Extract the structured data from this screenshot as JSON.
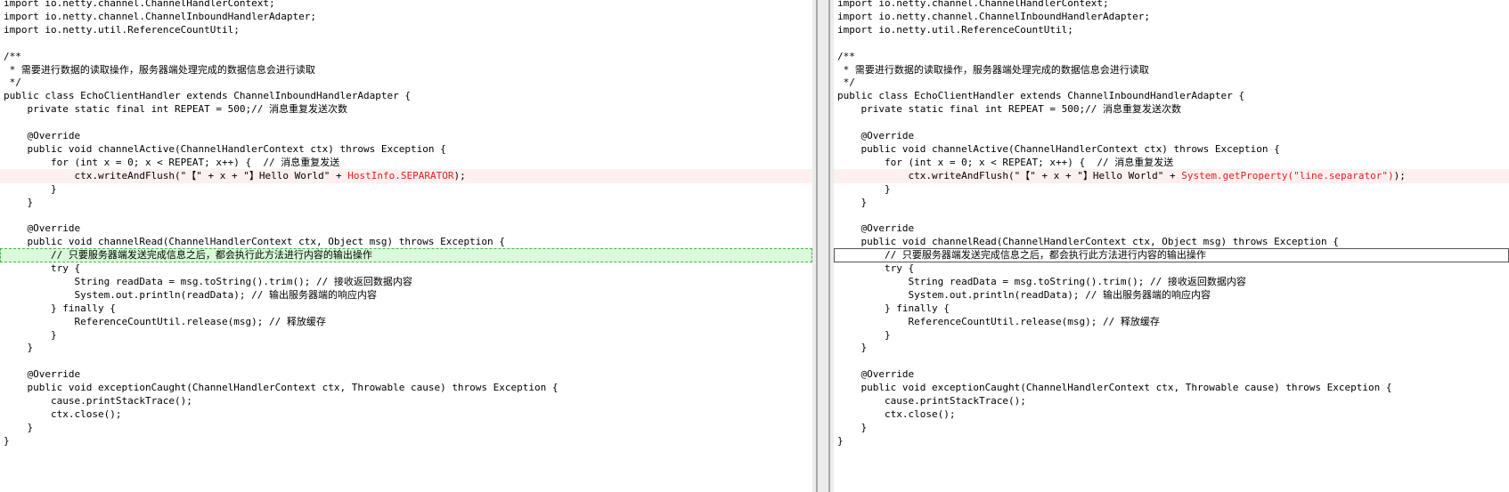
{
  "left": {
    "lines": [
      {
        "text": "import io.netty.channel.ChannelHandlerContext;"
      },
      {
        "text": "import io.netty.channel.ChannelInboundHandlerAdapter;"
      },
      {
        "text": "import io.netty.util.ReferenceCountUtil;"
      },
      {
        "text": ""
      },
      {
        "text": "/**"
      },
      {
        "text": " * 需要进行数据的读取操作，服务器端处理完成的数据信息会进行读取"
      },
      {
        "text": " */"
      },
      {
        "text": "public class EchoClientHandler extends ChannelInboundHandlerAdapter {"
      },
      {
        "text": "    private static final int REPEAT = 500;// 消息重复发送次数"
      },
      {
        "text": ""
      },
      {
        "text": "    @Override"
      },
      {
        "text": "    public void channelActive(ChannelHandlerContext ctx) throws Exception {"
      },
      {
        "text": "        for (int x = 0; x < REPEAT; x++) {  // 消息重复发送"
      },
      {
        "text": "            ctx.writeAndFlush(\"【\" + x + \"】Hello World\" + ",
        "hl": "HostInfo.SEPARATOR",
        "tail": ");",
        "state": "changed"
      },
      {
        "text": "        }"
      },
      {
        "text": "    }"
      },
      {
        "text": ""
      },
      {
        "text": "    @Override"
      },
      {
        "text": "    public void channelRead(ChannelHandlerContext ctx, Object msg) throws Exception {"
      },
      {
        "text": "        // 只要服务器端发送完成信息之后，都会执行此方法进行内容的输出操作",
        "state": "current"
      },
      {
        "text": "        try {"
      },
      {
        "text": "            String readData = msg.toString().trim(); // 接收返回数据内容"
      },
      {
        "text": "            System.out.println(readData); // 输出服务器端的响应内容"
      },
      {
        "text": "        } finally {"
      },
      {
        "text": "            ReferenceCountUtil.release(msg); // 释放缓存"
      },
      {
        "text": "        }"
      },
      {
        "text": "    }"
      },
      {
        "text": ""
      },
      {
        "text": "    @Override"
      },
      {
        "text": "    public void exceptionCaught(ChannelHandlerContext ctx, Throwable cause) throws Exception {"
      },
      {
        "text": "        cause.printStackTrace();"
      },
      {
        "text": "        ctx.close();"
      },
      {
        "text": "    }"
      },
      {
        "text": "}"
      }
    ]
  },
  "right": {
    "lines": [
      {
        "text": "import io.netty.channel.ChannelHandlerContext;"
      },
      {
        "text": "import io.netty.channel.ChannelInboundHandlerAdapter;"
      },
      {
        "text": "import io.netty.util.ReferenceCountUtil;"
      },
      {
        "text": ""
      },
      {
        "text": "/**"
      },
      {
        "text": " * 需要进行数据的读取操作，服务器端处理完成的数据信息会进行读取"
      },
      {
        "text": " */"
      },
      {
        "text": "public class EchoClientHandler extends ChannelInboundHandlerAdapter {"
      },
      {
        "text": "    private static final int REPEAT = 500;// 消息重复发送次数"
      },
      {
        "text": ""
      },
      {
        "text": "    @Override"
      },
      {
        "text": "    public void channelActive(ChannelHandlerContext ctx) throws Exception {"
      },
      {
        "text": "        for (int x = 0; x < REPEAT; x++) {  // 消息重复发送"
      },
      {
        "text": "            ctx.writeAndFlush(\"【\" + x + \"】Hello World\" + ",
        "hl": "System.getProperty(\"line.separator\")",
        "tail": ");",
        "state": "changed"
      },
      {
        "text": "        }"
      },
      {
        "text": "    }"
      },
      {
        "text": ""
      },
      {
        "text": "    @Override"
      },
      {
        "text": "    public void channelRead(ChannelHandlerContext ctx, Object msg) throws Exception {"
      },
      {
        "text": "        // 只要服务器端发送完成信息之后，都会执行此方法进行内容的输出操作",
        "state": "current"
      },
      {
        "text": "        try {"
      },
      {
        "text": "            String readData = msg.toString().trim(); // 接收返回数据内容"
      },
      {
        "text": "            System.out.println(readData); // 输出服务器端的响应内容"
      },
      {
        "text": "        } finally {"
      },
      {
        "text": "            ReferenceCountUtil.release(msg); // 释放缓存"
      },
      {
        "text": "        }"
      },
      {
        "text": "    }"
      },
      {
        "text": ""
      },
      {
        "text": "    @Override"
      },
      {
        "text": "    public void exceptionCaught(ChannelHandlerContext ctx, Throwable cause) throws Exception {"
      },
      {
        "text": "        cause.printStackTrace();"
      },
      {
        "text": "        ctx.close();"
      },
      {
        "text": "    }"
      },
      {
        "text": "}"
      }
    ]
  },
  "colors": {
    "changed_line_bg": "#fff0f0",
    "current_line_bg_left": "#d9fbd9",
    "changed_text": "#e02020"
  }
}
